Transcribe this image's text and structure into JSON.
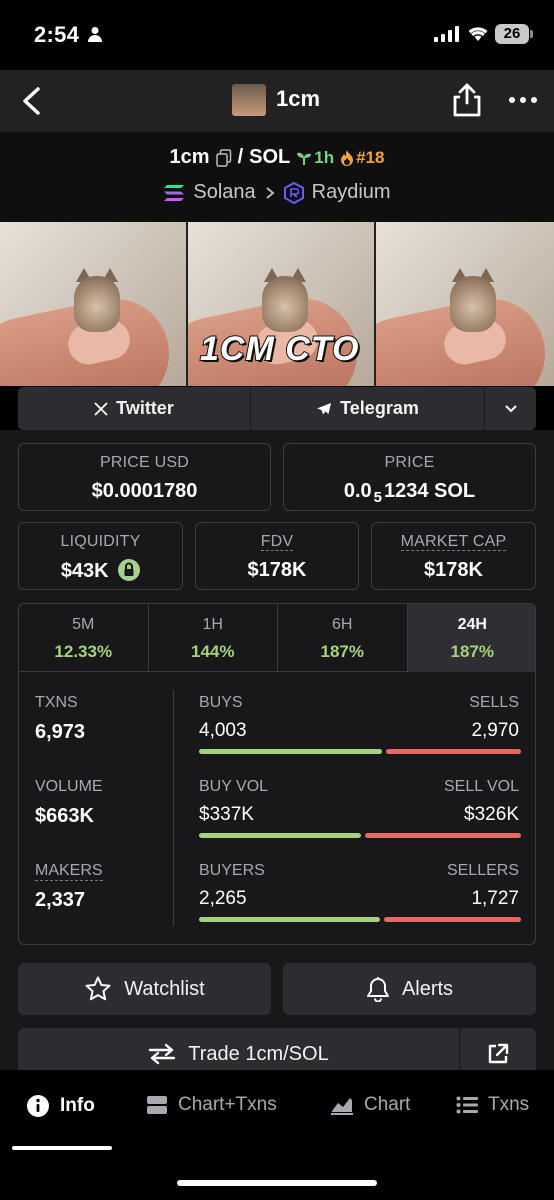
{
  "status_bar": {
    "time": "2:54",
    "battery": "26"
  },
  "nav": {
    "title": "1cm"
  },
  "pair": {
    "base": "1cm",
    "quote": "SOL",
    "separator": "/",
    "age": "1h",
    "rank": "#18",
    "chain": "Solana",
    "dex": "Raydium"
  },
  "banner": {
    "text": "1CM CTO"
  },
  "social": {
    "twitter": "Twitter",
    "telegram": "Telegram"
  },
  "metrics": {
    "price_usd": {
      "label": "PRICE USD",
      "value": "$0.0001780"
    },
    "price": {
      "label": "PRICE",
      "prefix": "0.0",
      "sub": "5",
      "suffix": "1234 SOL"
    },
    "liquidity": {
      "label": "LIQUIDITY",
      "value": "$43K"
    },
    "fdv": {
      "label": "FDV",
      "value": "$178K"
    },
    "market_cap": {
      "label": "MARKET CAP",
      "value": "$178K"
    }
  },
  "periods": [
    {
      "label": "5M",
      "value": "12.33%"
    },
    {
      "label": "1H",
      "value": "144%"
    },
    {
      "label": "6H",
      "value": "187%"
    },
    {
      "label": "24H",
      "value": "187%"
    }
  ],
  "stats": {
    "txns": {
      "label": "TXNS",
      "value": "6,973"
    },
    "volume": {
      "label": "VOLUME",
      "value": "$663K"
    },
    "makers": {
      "label": "MAKERS",
      "value": "2,337"
    },
    "buys": {
      "label": "BUYS",
      "value": "4,003",
      "share": 0.574
    },
    "sells": {
      "label": "SELLS",
      "value": "2,970"
    },
    "buy_vol": {
      "label": "BUY VOL",
      "value": "$337K",
      "share": 0.508
    },
    "sell_vol": {
      "label": "SELL VOL",
      "value": "$326K"
    },
    "buyers": {
      "label": "BUYERS",
      "value": "2,265",
      "share": 0.567
    },
    "sellers": {
      "label": "SELLERS",
      "value": "1,727"
    }
  },
  "actions": {
    "watchlist": "Watchlist",
    "alerts": "Alerts",
    "trade": "Trade 1cm/SOL"
  },
  "tabbar": [
    {
      "label": "Info",
      "icon": "info-icon"
    },
    {
      "label": "Chart+Txns",
      "icon": "chart-txns-icon"
    },
    {
      "label": "Chart",
      "icon": "chart-icon"
    },
    {
      "label": "Txns",
      "icon": "list-icon"
    }
  ],
  "colors": {
    "green": "#a4d27d",
    "red": "#e8675f",
    "rank_orange": "#f3a33a"
  }
}
